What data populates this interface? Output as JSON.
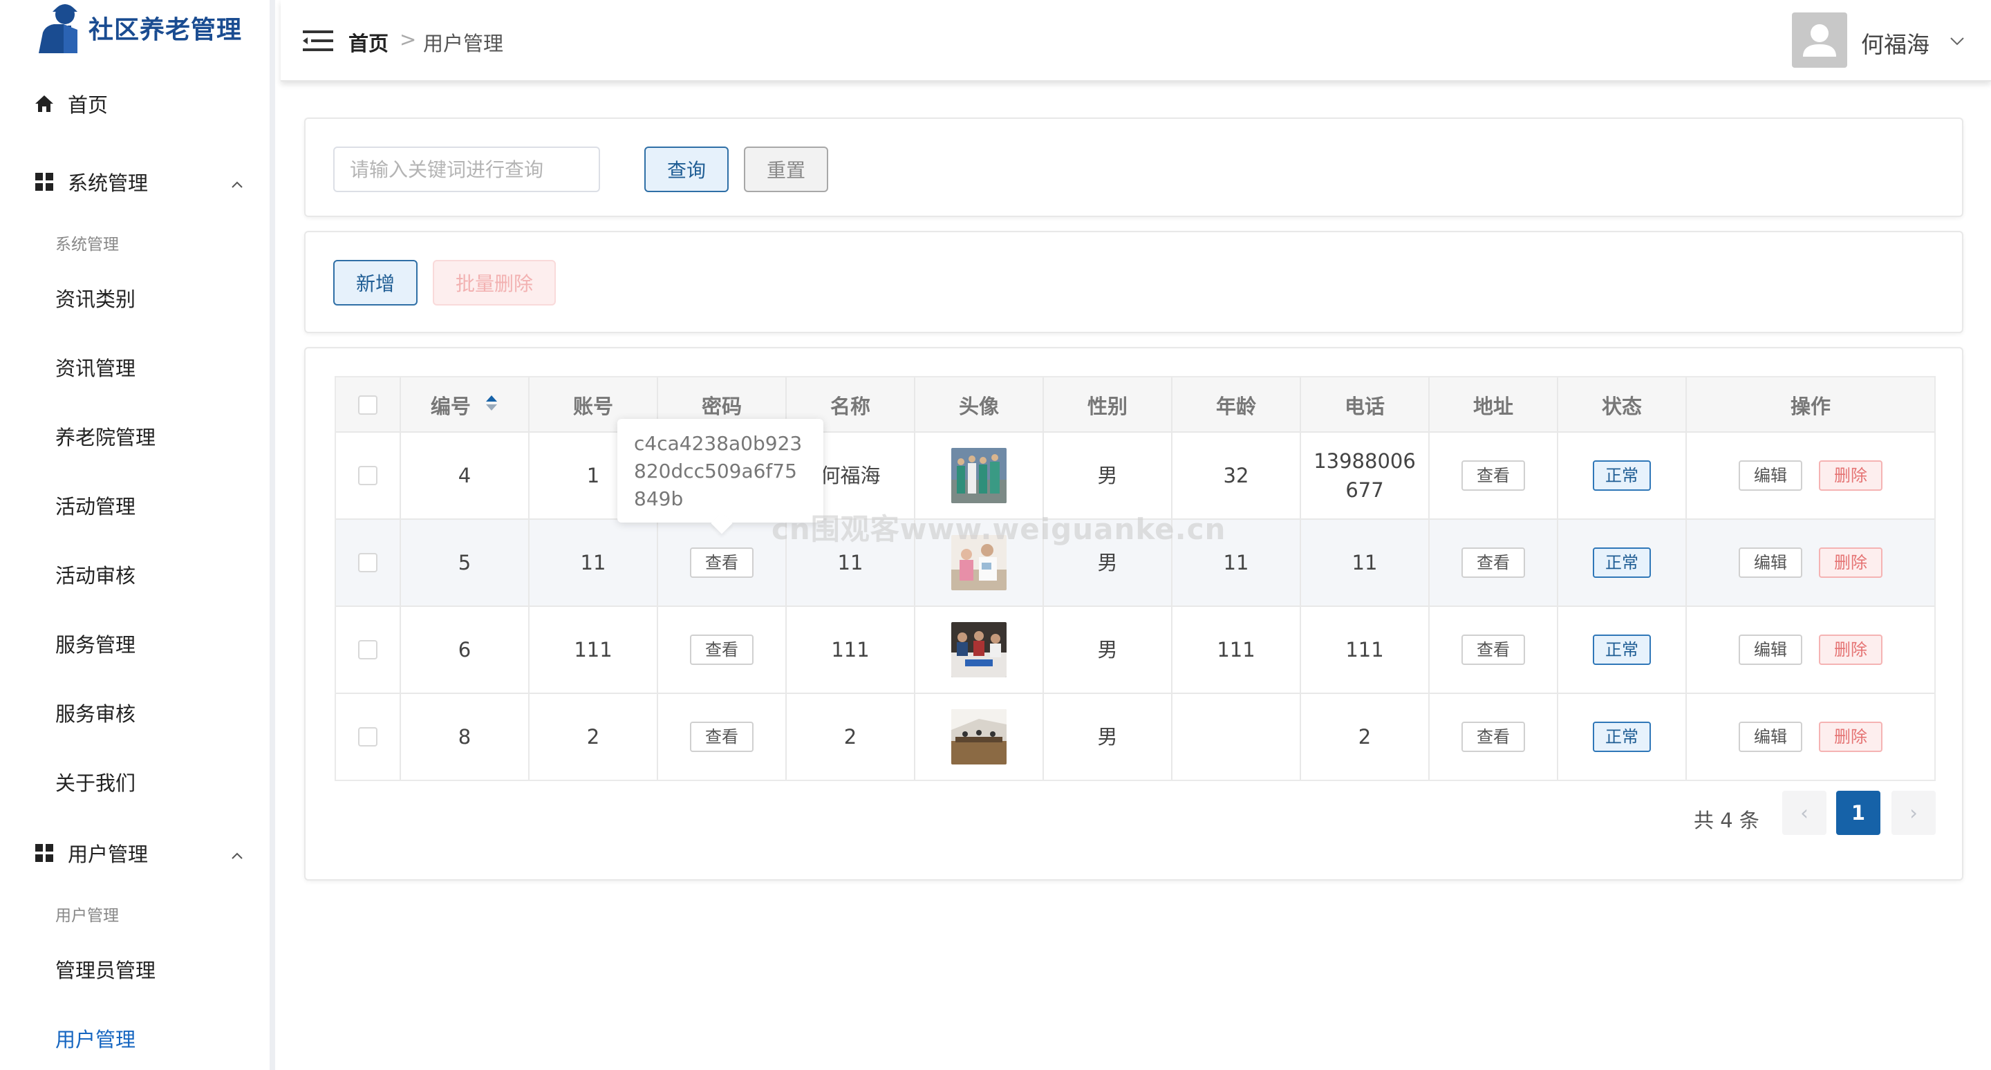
{
  "app": {
    "title": "社区养老管理"
  },
  "sidebar": {
    "home": "首页",
    "system_group": "系统管理",
    "system_sublabel": "系统管理",
    "system_items": [
      "资讯类别",
      "资讯管理",
      "养老院管理",
      "活动管理",
      "活动审核",
      "服务管理",
      "服务审核",
      "关于我们"
    ],
    "user_group": "用户管理",
    "user_sublabel": "用户管理",
    "user_items": [
      "管理员管理",
      "用户管理"
    ],
    "active_item": "用户管理"
  },
  "header": {
    "breadcrumb_home": "首页",
    "breadcrumb_sep": ">",
    "breadcrumb_current": "用户管理",
    "username": "何福海"
  },
  "search": {
    "placeholder": "请输入关键词进行查询",
    "query_label": "查询",
    "reset_label": "重置"
  },
  "actions": {
    "add_label": "新增",
    "batch_delete_label": "批量删除"
  },
  "table": {
    "headers": [
      "编号",
      "账号",
      "密码",
      "名称",
      "头像",
      "性别",
      "年龄",
      "电话",
      "地址",
      "状态",
      "操作"
    ],
    "view_label": "查看",
    "status_label": "正常",
    "edit_label": "编辑",
    "delete_label": "删除",
    "rows": [
      {
        "id": "4",
        "account": "1",
        "name": "何福海",
        "gender": "男",
        "age": "32",
        "phone_line1": "13988006",
        "phone_line2": "677"
      },
      {
        "id": "5",
        "account": "11",
        "name": "11",
        "gender": "男",
        "age": "11",
        "phone_line1": "11",
        "phone_line2": ""
      },
      {
        "id": "6",
        "account": "111",
        "name": "111",
        "gender": "男",
        "age": "111",
        "phone_line1": "111",
        "phone_line2": ""
      },
      {
        "id": "8",
        "account": "2",
        "name": "2",
        "gender": "男",
        "age": "",
        "phone_line1": "2",
        "phone_line2": ""
      }
    ]
  },
  "tooltip": {
    "text": "c4ca4238a0b923820dcc509a6f75849b"
  },
  "watermark": "cn围观客www.weiguanke.cn",
  "pagination": {
    "total": "共 4 条",
    "prev": "‹",
    "current": "1",
    "next": "›"
  },
  "colors": {
    "brand": "#1a4c91",
    "primary": "#1662a8",
    "danger": "#e57373"
  }
}
